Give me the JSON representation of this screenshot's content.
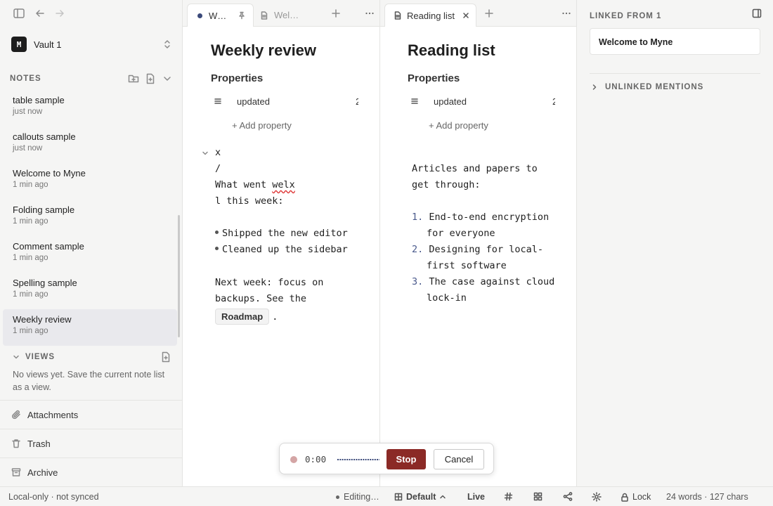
{
  "sidebar": {
    "vault_name": "Vault 1",
    "vault_initial": "M",
    "notes_label": "NOTES",
    "notes": [
      {
        "title": "table sample",
        "time": "just now"
      },
      {
        "title": "callouts sample",
        "time": "just now"
      },
      {
        "title": "Welcome to Myne",
        "time": "1 min ago"
      },
      {
        "title": "Folding sample",
        "time": "1 min ago"
      },
      {
        "title": "Comment sample",
        "time": "1 min ago"
      },
      {
        "title": "Spelling sample",
        "time": "1 min ago"
      },
      {
        "title": "Weekly review",
        "time": "1 min ago",
        "active": true
      }
    ],
    "views_label": "VIEWS",
    "views_empty": "No views yet. Save the current note list as a view.",
    "links": {
      "attachments": "Attachments",
      "trash": "Trash",
      "archive": "Archive"
    }
  },
  "pane1": {
    "tabs": [
      {
        "label": "W…",
        "pinned": true,
        "active": true
      },
      {
        "label": "Wel…",
        "active": false
      }
    ],
    "title": "Weekly review",
    "properties_label": "Properties",
    "property": {
      "name": "updated",
      "value": "2"
    },
    "add_property": "+ Add property",
    "content": {
      "l1": "x",
      "l2": "/",
      "l3a": "What went ",
      "l3b": "welx",
      "l4": "l this week:",
      "bullets": [
        "Shipped the new editor",
        "Cleaned up the sidebar"
      ],
      "l5": "Next week: focus on",
      "l6": "backups. See the",
      "chip": "Roadmap",
      "chip_after": "."
    }
  },
  "pane2": {
    "tab": {
      "label": "Reading list"
    },
    "title": "Reading list",
    "properties_label": "Properties",
    "property": {
      "name": "updated",
      "value": "2"
    },
    "add_property": "+ Add property",
    "content": {
      "l1": "Articles and papers to",
      "l2": "get through:",
      "items": [
        {
          "num": "1.",
          "a": "End-to-end encryption",
          "b": "for everyone"
        },
        {
          "num": "2.",
          "a": "Designing for local-",
          "b": "first software"
        },
        {
          "num": "3.",
          "a": "The case against cloud",
          "b": "lock-in"
        }
      ]
    }
  },
  "rightpanel": {
    "linked_label": "LINKED FROM 1",
    "linked_note": "Welcome to Myne",
    "unlinked_label": "UNLINKED MENTIONS"
  },
  "recorder": {
    "time": "0:00",
    "stop": "Stop",
    "cancel": "Cancel"
  },
  "statusbar": {
    "sync": "Local-only · not synced",
    "editing": "Editing…",
    "layout": "Default",
    "live": "Live",
    "lock": "Lock",
    "counts": "24 words · 127 chars"
  },
  "colors": {
    "accent": "#8b2a26",
    "active_note_bg": "#e9e9ed",
    "tab_dot": "#3b4a7a"
  }
}
